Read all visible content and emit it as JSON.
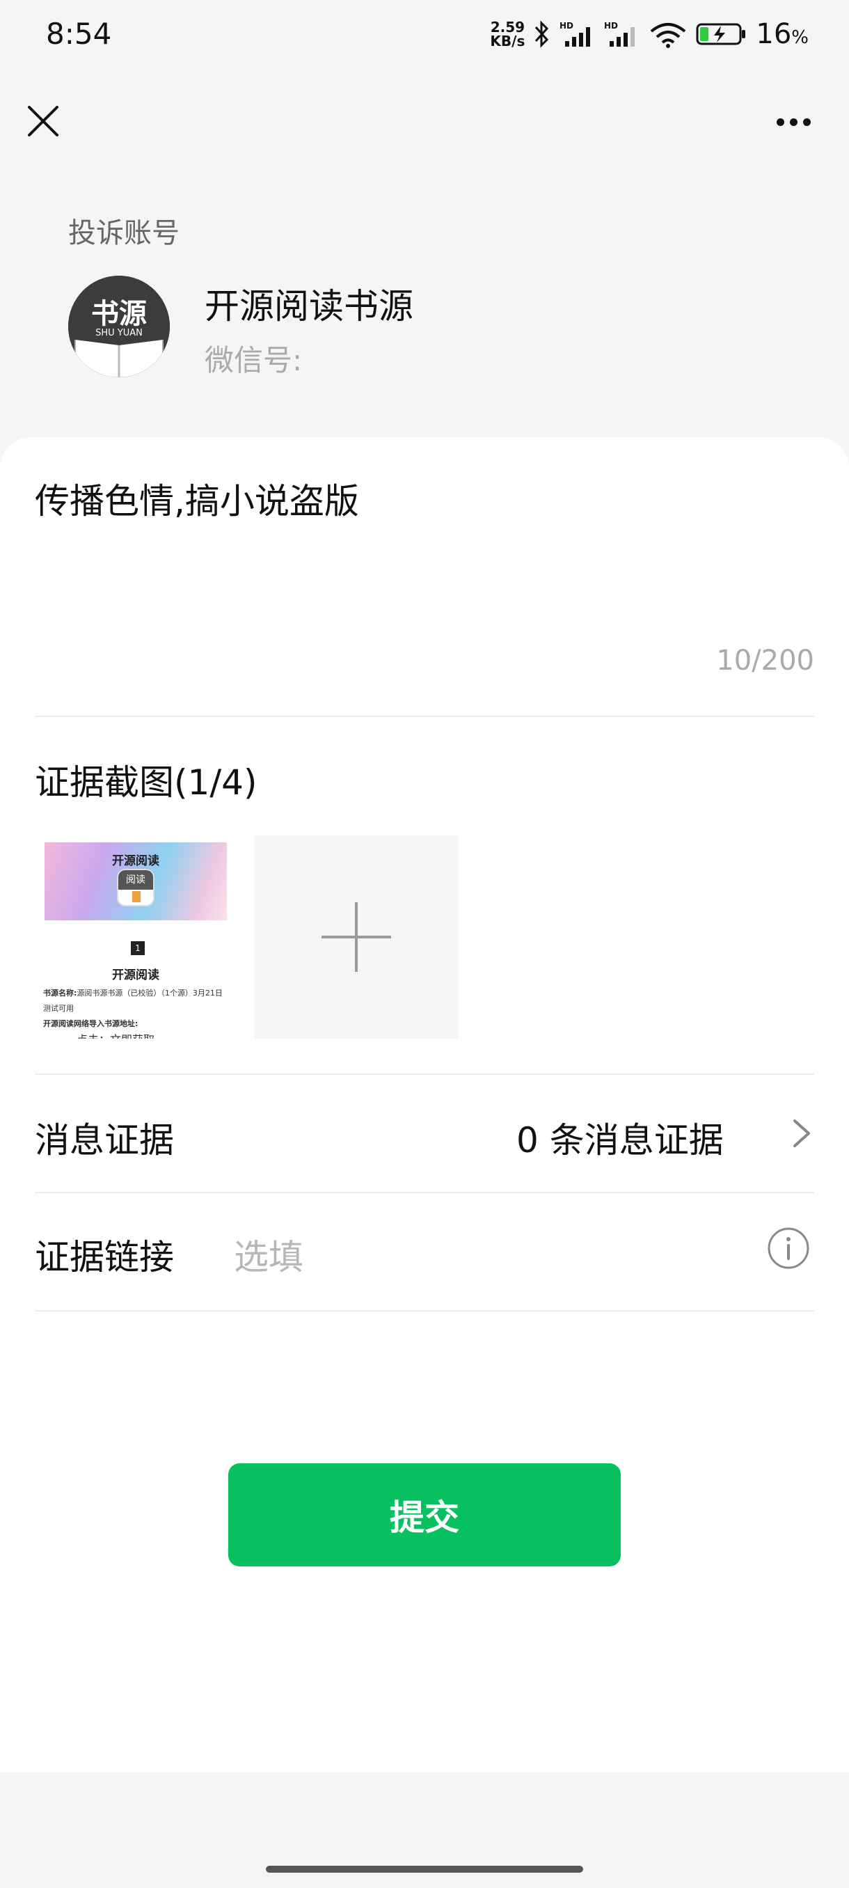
{
  "status_bar": {
    "time": "8:54",
    "net_speed_value": "2.59",
    "net_speed_unit": "KB/s",
    "battery_percent": "16",
    "battery_unit": "%"
  },
  "nav": {
    "close_icon": "close-icon",
    "more_icon": "more-icon"
  },
  "account": {
    "section_label": "投诉账号",
    "name": "开源阅读书源",
    "wechat_id_label": "微信号:",
    "avatar_text_big": "书源",
    "avatar_text_small": "SHU YUAN"
  },
  "reason": {
    "text": "传播色情,搞小说盗版",
    "counter": "10/200"
  },
  "evidence_screenshots": {
    "title": "证据截图(1/4)",
    "thumbnail": {
      "banner_title": "开源阅读",
      "app_icon_text": "阅读",
      "index": "1",
      "heading": "开源阅读",
      "line1_label": "书源名称:",
      "line1_value": "源阅书源书源（已校验）（1个源）3月21日",
      "line2": "测试可用",
      "line3": "开源阅读网络导入书源地址:",
      "line4": "点击：文即获取"
    },
    "add_icon": "plus-icon"
  },
  "message_evidence": {
    "label": "消息证据",
    "value": "0 条消息证据"
  },
  "evidence_link": {
    "label": "证据链接",
    "placeholder": "选填"
  },
  "submit_label": "提交",
  "colors": {
    "accent_green": "#07c160",
    "background": "#f5f5f5",
    "sheet": "#ffffff"
  }
}
